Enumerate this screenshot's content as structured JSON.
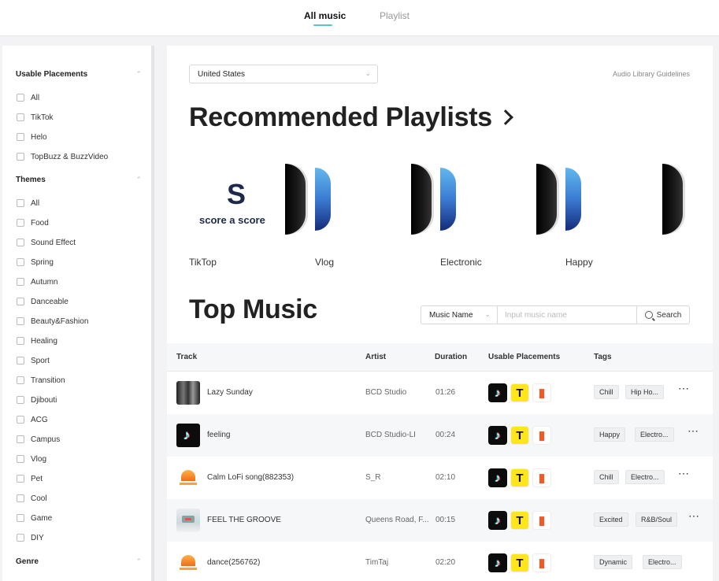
{
  "nav": {
    "tabs": [
      {
        "label": "All music"
      },
      {
        "label": "Playlist"
      }
    ]
  },
  "sidebar": {
    "sections": [
      {
        "title": "Usable Placements",
        "items": [
          "All",
          "TikTok",
          "Helo",
          "TopBuzz & BuzzVideo"
        ]
      },
      {
        "title": "Themes",
        "items": [
          "All",
          "Food",
          "Sound Effect",
          "Spring",
          "Autumn",
          "Danceable",
          "Beauty&Fashion",
          "Healing",
          "Sport",
          "Transition",
          "Djibouti",
          "ACG",
          "Campus",
          "Vlog",
          "Pet",
          "Cool",
          "Game",
          "DIY"
        ]
      },
      {
        "title": "Genre",
        "items": []
      }
    ]
  },
  "main": {
    "country": "United States",
    "guidelines": "Audio Library Guidelines",
    "recommended_title": "Recommended Playlists",
    "playlist_logo": {
      "mark": "S",
      "text": "score a score"
    },
    "playlists": [
      {
        "label": "TikTop"
      },
      {
        "label": "Vlog"
      },
      {
        "label": "Electronic"
      },
      {
        "label": "Happy"
      }
    ],
    "top_music_title": "Top Music",
    "search": {
      "type": "Music Name",
      "placeholder": "Input music name",
      "button": "Search"
    },
    "columns": [
      "Track",
      "Artist",
      "Duration",
      "Usable Placements",
      "Tags"
    ],
    "tracks": [
      {
        "name": "Lazy Sunday",
        "artist": "BCD Studio",
        "duration": "01:26",
        "tags": [
          "Chill",
          "Hip Ho..."
        ]
      },
      {
        "name": "feeling",
        "artist": "BCD Studio-LI",
        "duration": "00:24",
        "tags": [
          "Happy",
          "Electro..."
        ]
      },
      {
        "name": "Calm LoFi song(882353)",
        "artist": "S_R",
        "duration": "02:10",
        "tags": [
          "Chill",
          "Electro..."
        ]
      },
      {
        "name": "FEEL THE GROOVE",
        "artist": "Queens Road, F...",
        "duration": "00:15",
        "tags": [
          "Excited",
          "R&B/Soul"
        ]
      },
      {
        "name": "dance(256762)",
        "artist": "TimTaj",
        "duration": "02:20",
        "tags": [
          "Dynamic",
          "Electro..."
        ]
      }
    ],
    "placement_icons": {
      "tiktok": "tiktok-icon",
      "topbuzz": "topbuzz-icon",
      "helo": "helo-icon"
    },
    "colors": {
      "accent": "#53c7c9",
      "topbuzz": "#ffe61a",
      "helo": "#f15a24"
    }
  }
}
